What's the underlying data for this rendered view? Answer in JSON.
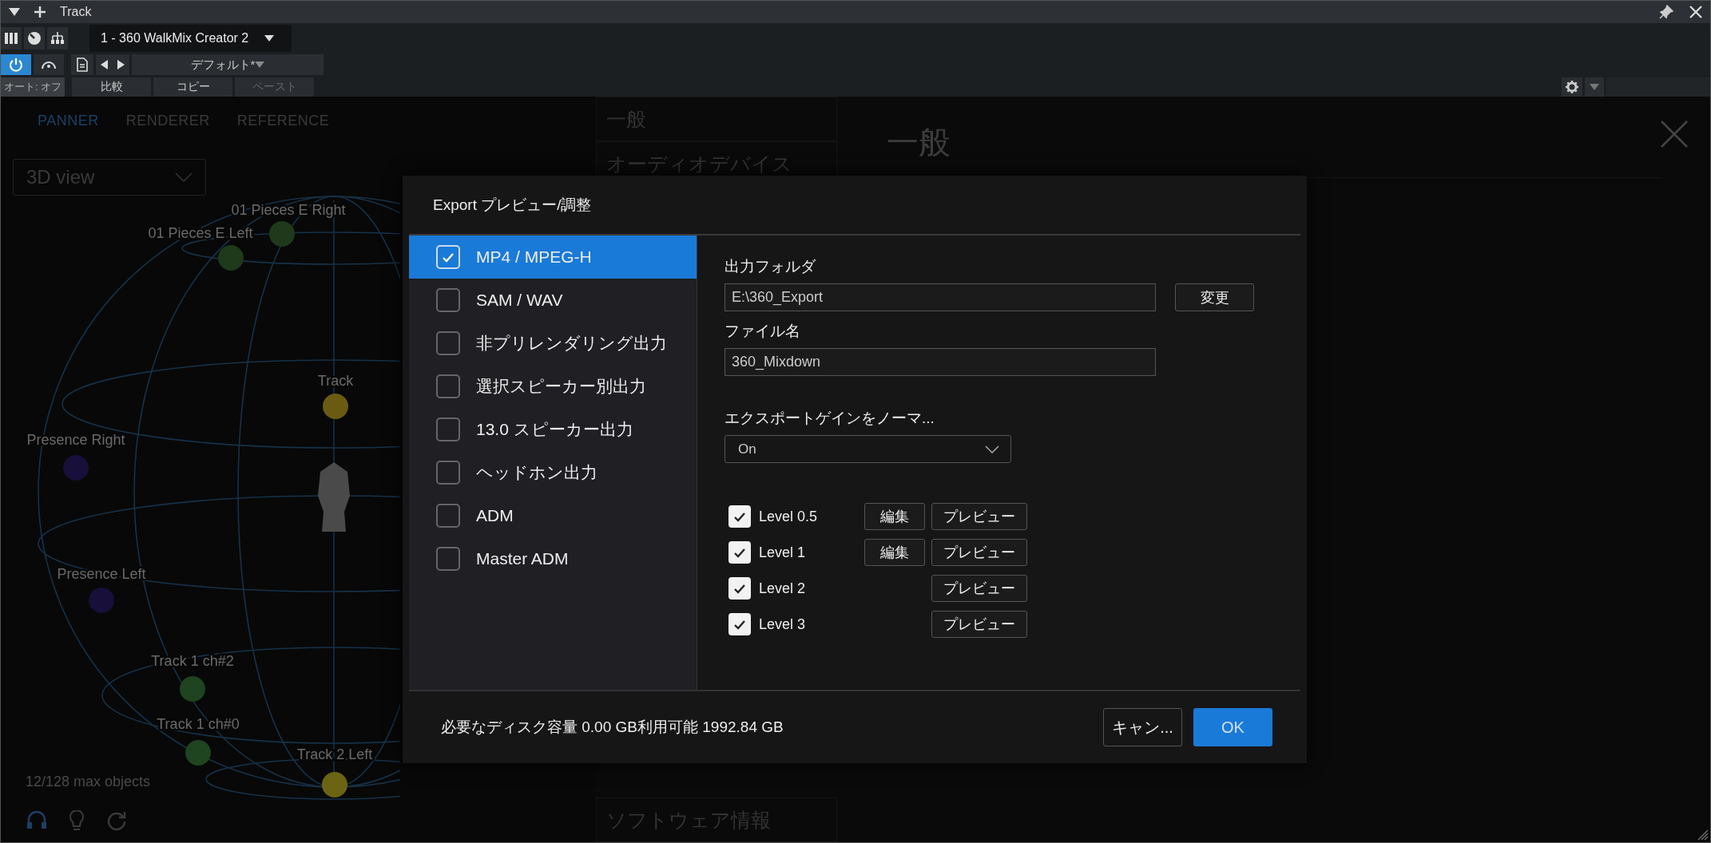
{
  "window": {
    "title": "Track"
  },
  "toolbar": {
    "preset_name": "1 - 360 WalkMix Creator 2",
    "power_on": true,
    "preset": "デフォルト*",
    "auto_label": "オート: オフ",
    "buttons": [
      {
        "label": "比較",
        "disabled": false
      },
      {
        "label": "コピー",
        "disabled": false
      },
      {
        "label": "ペースト",
        "disabled": true
      }
    ]
  },
  "plugin": {
    "tabs": [
      {
        "label": "PANNER",
        "selected": true
      },
      {
        "label": "RENDERER",
        "selected": false
      },
      {
        "label": "REFERENCE",
        "selected": false
      }
    ],
    "view_select": "3D view",
    "objects": [
      {
        "label": "01 Pieces E Right",
        "color": "#1e3a1a"
      },
      {
        "label": "01 Pieces E Left",
        "color": "#1e3a1a"
      },
      {
        "label": "Track",
        "color": "#6b5a12"
      },
      {
        "label": "Presence Right",
        "color": "#180f3a"
      },
      {
        "label": "Presence Left",
        "color": "#180f3a"
      },
      {
        "label": "Track 1 ch#2",
        "color": "#1f4420"
      },
      {
        "label": "Track 1 ch#0",
        "color": "#1f4420"
      },
      {
        "label": "Track 2 Left",
        "color": "#6b6414"
      }
    ],
    "object_count": "12/128 max objects"
  },
  "settings_nav": {
    "items": [
      {
        "label": "一般"
      },
      {
        "label": "オーディオデバイス"
      },
      {
        "label": "ソフトウェア情報"
      }
    ]
  },
  "settings_page": {
    "title": "一般"
  },
  "dialog": {
    "title": "Export プレビュー/調整",
    "formats": [
      {
        "label": "MP4 / MPEG-H",
        "checked": true,
        "selected": true
      },
      {
        "label": "SAM / WAV",
        "checked": false,
        "selected": false
      },
      {
        "label": "非プリレンダリング出力",
        "checked": false,
        "selected": false
      },
      {
        "label": "選択スピーカー別出力",
        "checked": false,
        "selected": false
      },
      {
        "label": "13.0 スピーカー出力",
        "checked": false,
        "selected": false
      },
      {
        "label": "ヘッドホン出力",
        "checked": false,
        "selected": false
      },
      {
        "label": "ADM",
        "checked": false,
        "selected": false
      },
      {
        "label": "Master ADM",
        "checked": false,
        "selected": false
      }
    ],
    "output_folder": {
      "label": "出力フォルダ",
      "value": "E:\\360_Export",
      "button": "変更"
    },
    "file_name": {
      "label": "ファイル名",
      "value": "360_Mixdown"
    },
    "normalize": {
      "label": "エクスポートゲインをノーマ...",
      "value": "On"
    },
    "levels": [
      {
        "label": "Level 0.5",
        "checked": true,
        "edit": "編集",
        "preview": "プレビュー"
      },
      {
        "label": "Level 1",
        "checked": true,
        "edit": "編集",
        "preview": "プレビュー"
      },
      {
        "label": "Level 2",
        "checked": true,
        "preview": "プレビュー"
      },
      {
        "label": "Level 3",
        "checked": true,
        "preview": "プレビュー"
      }
    ],
    "disk_info": "必要なディスク容量 0.00 GB利用可能 1992.84 GB",
    "cancel": "キャン...",
    "ok": "OK"
  }
}
